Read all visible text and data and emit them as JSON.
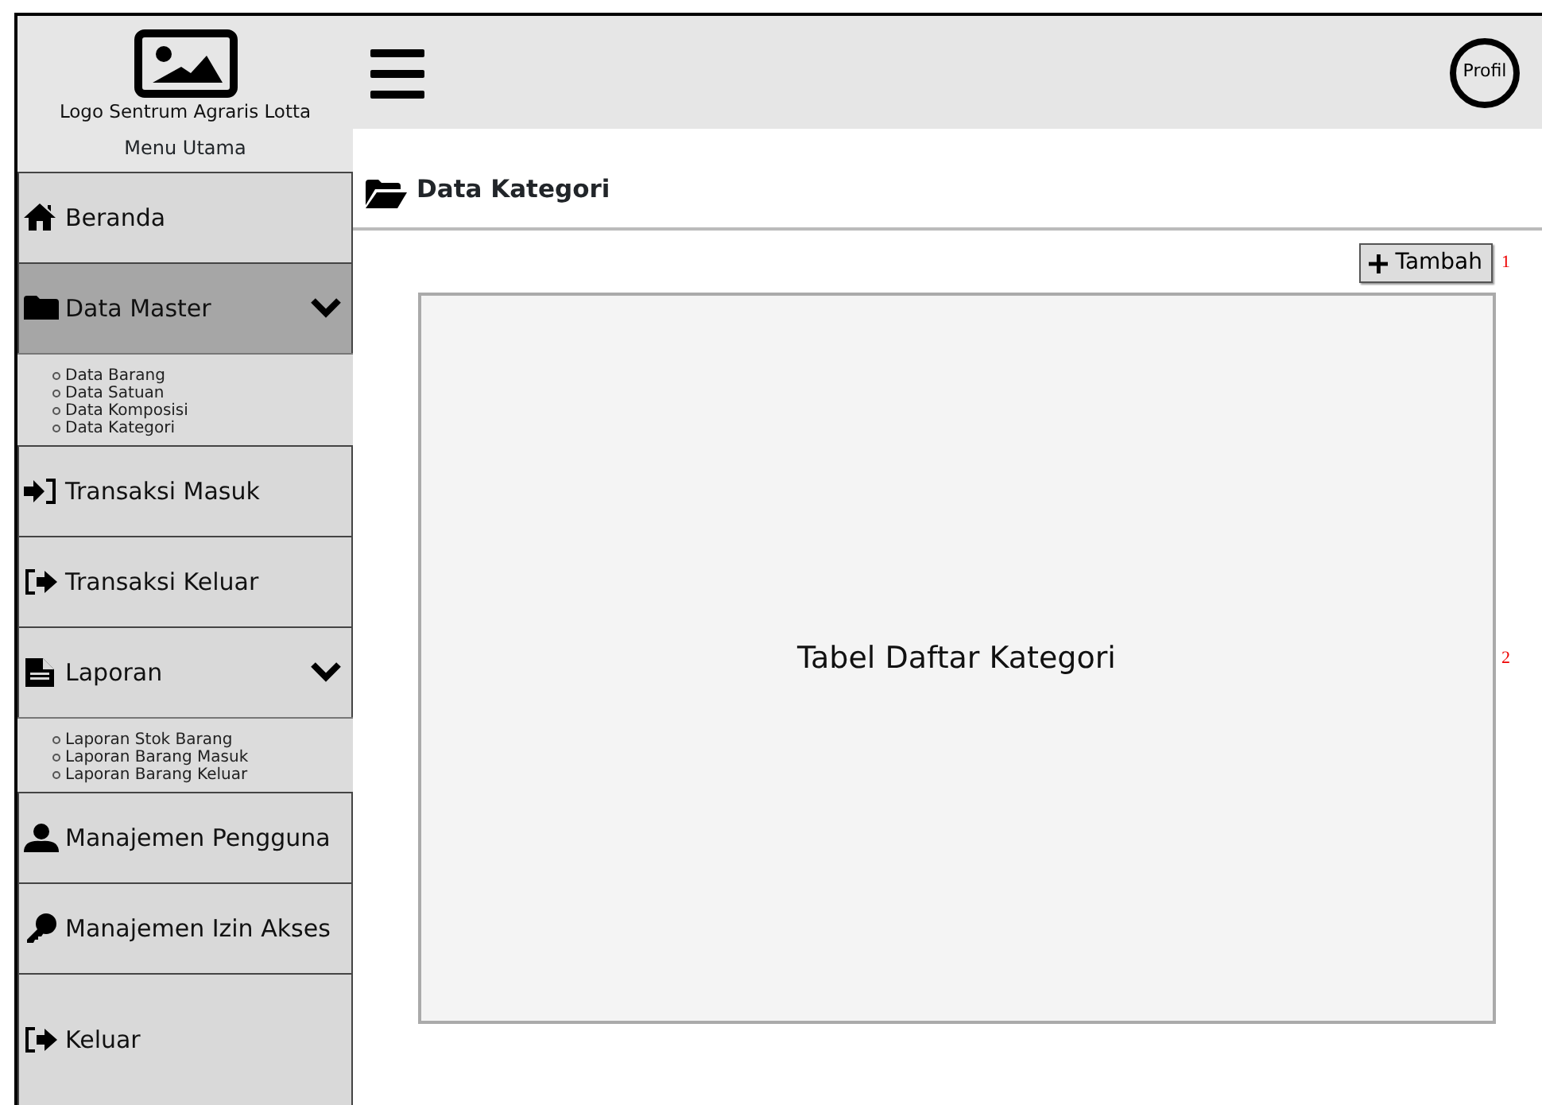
{
  "header": {
    "logo_caption": "Logo Sentrum Agraris Lotta",
    "profile": "Profil"
  },
  "sidebar": {
    "title": "Menu Utama",
    "items": [
      {
        "label": "Beranda",
        "selected": false
      },
      {
        "label": "Data Master",
        "selected": true,
        "expanded": true,
        "children": [
          {
            "label": "Data Barang"
          },
          {
            "label": "Data Satuan"
          },
          {
            "label": "Data Komposisi"
          },
          {
            "label": "Data Kategori"
          }
        ]
      },
      {
        "label": "Transaksi Masuk",
        "selected": false
      },
      {
        "label": "Transaksi Keluar",
        "selected": false
      },
      {
        "label": "Laporan",
        "selected": false,
        "expanded": true,
        "children": [
          {
            "label": "Laporan Stok Barang"
          },
          {
            "label": "Laporan Barang Masuk"
          },
          {
            "label": "Laporan Barang Keluar"
          }
        ]
      },
      {
        "label": "Manajemen Pengguna",
        "selected": false
      },
      {
        "label": "Manajemen Izin Akses",
        "selected": false
      },
      {
        "label": "Keluar",
        "selected": false
      }
    ]
  },
  "page": {
    "title": "Data Kategori",
    "add_button": {
      "label": "Tambah",
      "annotation": "1"
    },
    "table": {
      "placeholder": "Tabel Daftar Kategori",
      "annotation": "2"
    }
  }
}
